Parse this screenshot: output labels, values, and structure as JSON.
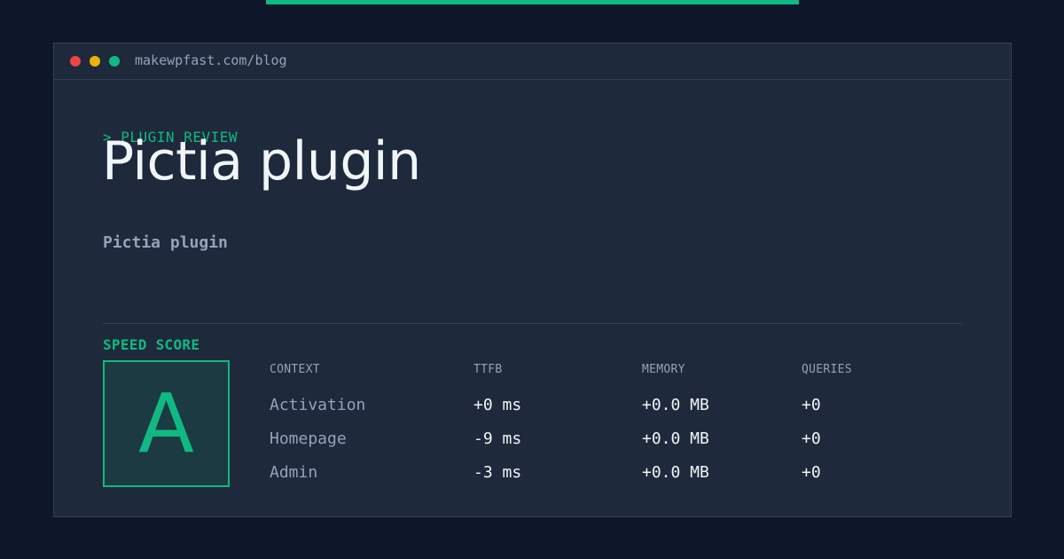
{
  "window": {
    "url": "makewpfast.com/blog"
  },
  "post": {
    "eyebrow": "> PLUGIN REVIEW",
    "title": "Pictia plugin",
    "subtitle": "Pictia plugin"
  },
  "score": {
    "label": "SPEED SCORE",
    "grade": "A"
  },
  "metrics": {
    "headers": [
      "CONTEXT",
      "TTFB",
      "MEMORY",
      "QUERIES"
    ],
    "rows": [
      [
        "Activation",
        "+0 ms",
        "+0.0 MB",
        "+0"
      ],
      [
        "Homepage",
        "-9 ms",
        "+0.0 MB",
        "+0"
      ],
      [
        "Admin",
        "-3 ms",
        "+0.0 MB",
        "+0"
      ]
    ]
  },
  "colors": {
    "accent": "#10b981",
    "background": "#0e1729",
    "panel": "#1e293b",
    "muted": "#94a3b8",
    "text": "#f1f5f9",
    "dot_red": "#ef4444",
    "dot_yellow": "#eab308",
    "dot_green": "#10b981"
  }
}
